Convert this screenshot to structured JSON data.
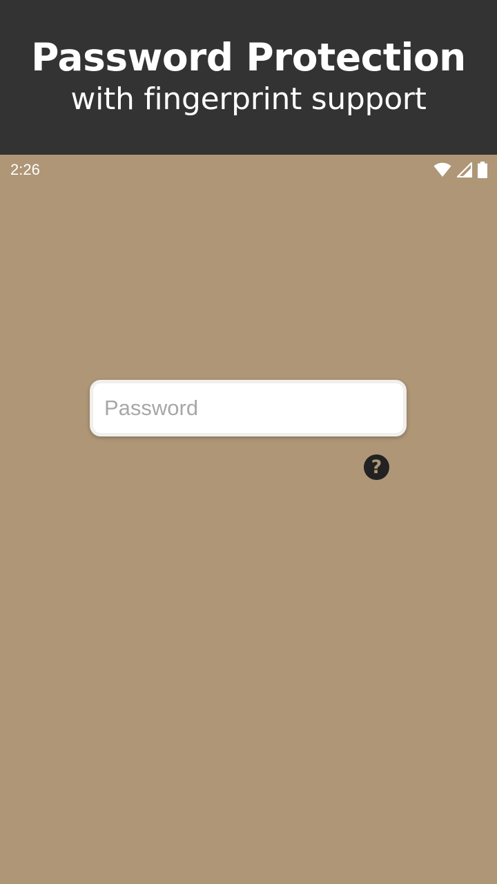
{
  "banner": {
    "title": "Password Protection",
    "subtitle": "with fingerprint support"
  },
  "status_bar": {
    "time": "2:26",
    "icons": [
      "wifi-icon",
      "cellular-signal-icon",
      "battery-icon"
    ]
  },
  "login": {
    "password_placeholder": "Password",
    "password_value": "",
    "help_glyph": "?"
  },
  "colors": {
    "background": "#ae9677",
    "banner": "#333333",
    "field": "#ffffff",
    "help_icon": "#222222"
  }
}
